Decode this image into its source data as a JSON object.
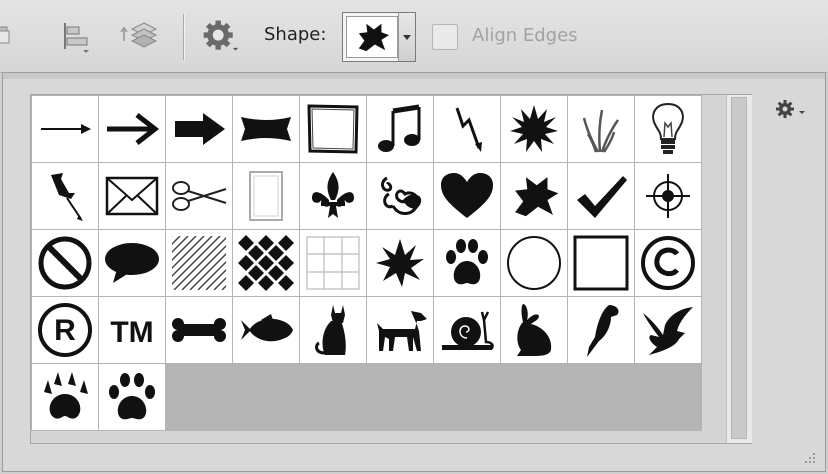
{
  "toolbar": {
    "shape_label": "Shape:",
    "align_edges_label": "Align Edges",
    "align_edges_checked": false,
    "selected_shape": "splat-icon",
    "buttons": [
      "path-operations-icon",
      "path-alignment-icon",
      "path-arrangement-icon",
      "geometry-options-gear-icon"
    ]
  },
  "panel": {
    "menu_icon": "gear-menu-icon",
    "shapes": [
      {
        "name": "thin-arrow-icon"
      },
      {
        "name": "arrow-icon"
      },
      {
        "name": "bold-arrow-icon"
      },
      {
        "name": "banner-icon"
      },
      {
        "name": "frame-icon"
      },
      {
        "name": "music-note-icon"
      },
      {
        "name": "lightning-icon"
      },
      {
        "name": "starburst-icon"
      },
      {
        "name": "grass-icon"
      },
      {
        "name": "lightbulb-icon"
      },
      {
        "name": "pushpin-icon"
      },
      {
        "name": "envelope-icon"
      },
      {
        "name": "scissors-icon"
      },
      {
        "name": "blank-page-icon"
      },
      {
        "name": "fleur-de-lis-icon"
      },
      {
        "name": "ornament-icon"
      },
      {
        "name": "heart-icon"
      },
      {
        "name": "splat-icon"
      },
      {
        "name": "checkmark-icon"
      },
      {
        "name": "crosshair-icon"
      },
      {
        "name": "no-sign-icon"
      },
      {
        "name": "speech-bubble-icon"
      },
      {
        "name": "diagonal-hatch-icon"
      },
      {
        "name": "diamond-grid-icon"
      },
      {
        "name": "square-grid-icon"
      },
      {
        "name": "explosion-icon"
      },
      {
        "name": "paw-print-icon"
      },
      {
        "name": "circle-icon"
      },
      {
        "name": "square-icon"
      },
      {
        "name": "copyright-icon"
      },
      {
        "name": "registered-icon",
        "text": "R"
      },
      {
        "name": "trademark-icon",
        "text": "TM"
      },
      {
        "name": "bone-icon"
      },
      {
        "name": "fish-icon"
      },
      {
        "name": "cat-icon"
      },
      {
        "name": "dog-icon"
      },
      {
        "name": "snail-icon"
      },
      {
        "name": "rabbit-icon"
      },
      {
        "name": "bird-icon"
      },
      {
        "name": "dove-icon"
      },
      {
        "name": "claw-print-icon"
      },
      {
        "name": "paw-print-2-icon"
      }
    ]
  }
}
